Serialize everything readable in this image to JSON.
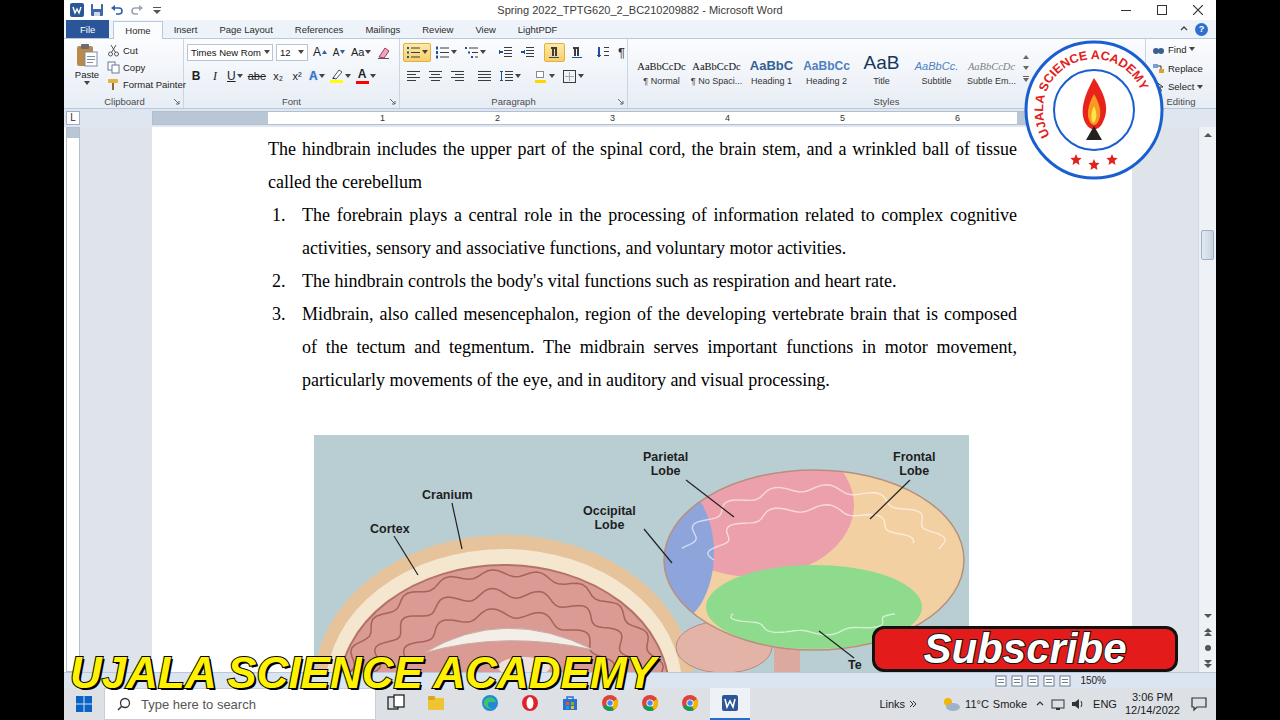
{
  "window": {
    "title": "Spring 2022_TPTG620_2_BC210209882 - Microsoft Word",
    "help": "?"
  },
  "ribbon_tabs": [
    {
      "label": "File",
      "kind": "file",
      "selected": false
    },
    {
      "label": "Home",
      "kind": "tab",
      "selected": true
    },
    {
      "label": "Insert",
      "kind": "tab",
      "selected": false
    },
    {
      "label": "Page Layout",
      "kind": "tab",
      "selected": false
    },
    {
      "label": "References",
      "kind": "tab",
      "selected": false
    },
    {
      "label": "Mailings",
      "kind": "tab",
      "selected": false
    },
    {
      "label": "Review",
      "kind": "tab",
      "selected": false
    },
    {
      "label": "View",
      "kind": "tab",
      "selected": false
    },
    {
      "label": "LightPDF",
      "kind": "tab",
      "selected": false
    }
  ],
  "clipboard": {
    "label": "Clipboard",
    "paste": "Paste",
    "items": [
      {
        "label": "Cut",
        "kind": "cut"
      },
      {
        "label": "Copy",
        "kind": "copy"
      },
      {
        "label": "Format Painter",
        "kind": "painter"
      }
    ]
  },
  "font": {
    "label": "Font",
    "family": "Times New Rom",
    "size": "12",
    "row1": [
      {
        "text": "A",
        "kind": "grow"
      },
      {
        "text": "A",
        "kind": "shrink"
      },
      {
        "text": "Aa",
        "kind": "case"
      },
      {
        "kind": "clear"
      }
    ],
    "row2": [
      {
        "text": "B",
        "kind": "bold"
      },
      {
        "text": "I",
        "kind": "italic"
      },
      {
        "text": "U",
        "kind": "underline"
      },
      {
        "text": "abe",
        "kind": "strike"
      },
      {
        "text": "x₂",
        "kind": "sub"
      },
      {
        "text": "x²",
        "kind": "sup"
      },
      {
        "text": "A",
        "kind": "effects"
      },
      {
        "kind": "highlight",
        "color": "#ffff00"
      },
      {
        "text": "A",
        "kind": "color",
        "color": "#ff0000"
      }
    ]
  },
  "paragraph": {
    "label": "Paragraph",
    "row1": [
      {
        "kind": "bullets",
        "selected": true
      },
      {
        "kind": "numbering",
        "selected": false
      },
      {
        "kind": "multilevel",
        "selected": false
      },
      {
        "kind": "outdent",
        "selected": false
      },
      {
        "kind": "indent",
        "selected": false
      },
      {
        "kind": "ltr",
        "selected": true
      },
      {
        "kind": "rtl",
        "selected": false
      },
      {
        "kind": "sort",
        "selected": false
      },
      {
        "kind": "marks",
        "text": "¶",
        "selected": false
      }
    ],
    "row2": [
      {
        "kind": "left",
        "selected": false
      },
      {
        "kind": "center",
        "selected": false
      },
      {
        "kind": "right",
        "selected": false
      },
      {
        "kind": "justify",
        "selected": false
      },
      {
        "kind": "spacing",
        "selected": false
      },
      {
        "kind": "shading",
        "selected": false
      },
      {
        "kind": "borders",
        "selected": false
      }
    ]
  },
  "styles": {
    "label": "Styles",
    "items": [
      {
        "sample": "AaBbCcDc",
        "label": "¶ Normal",
        "kind": "normal",
        "selected": false
      },
      {
        "sample": "AaBbCcDc",
        "label": "¶ No Spaci...",
        "kind": "nospacing",
        "selected": false
      },
      {
        "sample": "AaBbC",
        "label": "Heading 1",
        "kind": "heading1",
        "selected": false
      },
      {
        "sample": "AaBbCc",
        "label": "Heading 2",
        "kind": "heading2",
        "selected": false
      },
      {
        "sample": "AaB",
        "label": "Title",
        "kind": "title",
        "selected": false
      },
      {
        "sample": "AaBbCc.",
        "label": "Subtitle",
        "kind": "subtitle",
        "selected": false
      },
      {
        "sample": "AaBbCcDc",
        "label": "Subtle Em...",
        "kind": "subtle",
        "selected": false
      }
    ]
  },
  "editing": {
    "label": "Editing",
    "items": [
      {
        "label": "Find",
        "kind": "find",
        "dropdown": true
      },
      {
        "label": "Replace",
        "kind": "replace",
        "dropdown": false
      },
      {
        "label": "Select",
        "kind": "select",
        "dropdown": true
      }
    ]
  },
  "ruler": {
    "tab_selector": "L",
    "marks": [
      "1",
      "2",
      "3",
      "4",
      "5",
      "6"
    ]
  },
  "document": {
    "intro": "The hindbrain includes the upper part of the spinal cord, the brain stem, and a wrinkled ball of tissue called the cerebellum",
    "list": [
      {
        "number": "1.",
        "text": "The forebrain plays a central role in the processing of information related to complex cognitive activities, sensory and associative functions, and voluntary motor activities."
      },
      {
        "number": "2.",
        "text": "The hindbrain controls the body's vital functions such as respiration and heart rate."
      },
      {
        "number": "3.",
        "text": "Midbrain, also called mesencephalon, region of the developing vertebrate brain that is composed of the tectum and tegmentum. The midbrain serves important functions in motor movement, particularly movements of the eye, and in auditory and visual processing."
      }
    ],
    "scroll_position": 0.2,
    "figure": {
      "labels": [
        {
          "kind": "cranium",
          "lines": [
            "Cranium"
          ]
        },
        {
          "kind": "cortex",
          "lines": [
            "Cortex"
          ]
        },
        {
          "kind": "parietal",
          "lines": [
            "Parietal",
            "Lobe"
          ]
        },
        {
          "kind": "frontal",
          "lines": [
            "Frontal",
            "Lobe"
          ]
        },
        {
          "kind": "occipital",
          "lines": [
            "Occipital",
            "Lobe"
          ]
        },
        {
          "kind": "temporal",
          "lines": [
            "Te"
          ]
        }
      ]
    }
  },
  "status_bar": {
    "zoom": "150%"
  },
  "taskbar": {
    "search_placeholder": "Type here to search",
    "apps": [
      {
        "kind": "task-view",
        "active": false
      },
      {
        "kind": "files",
        "active": false
      },
      {
        "kind": "edge",
        "active": false
      },
      {
        "kind": "opera",
        "active": false
      },
      {
        "kind": "store",
        "active": false
      },
      {
        "kind": "chrome",
        "active": false
      },
      {
        "kind": "chrome",
        "active": false
      },
      {
        "kind": "chrome",
        "active": false
      },
      {
        "kind": "word",
        "active": true
      }
    ],
    "links": "Links",
    "weather": {
      "temperature": "11°C",
      "condition": "Smoke"
    },
    "language": "ENG",
    "time": "3:06 PM",
    "date": "12/14/2022"
  },
  "overlays": {
    "logo_text": "UJALA SCIENCE ACADEMY",
    "subscribe": "Subscribe",
    "banner": "UJALA SCIENCE ACADEMY"
  }
}
